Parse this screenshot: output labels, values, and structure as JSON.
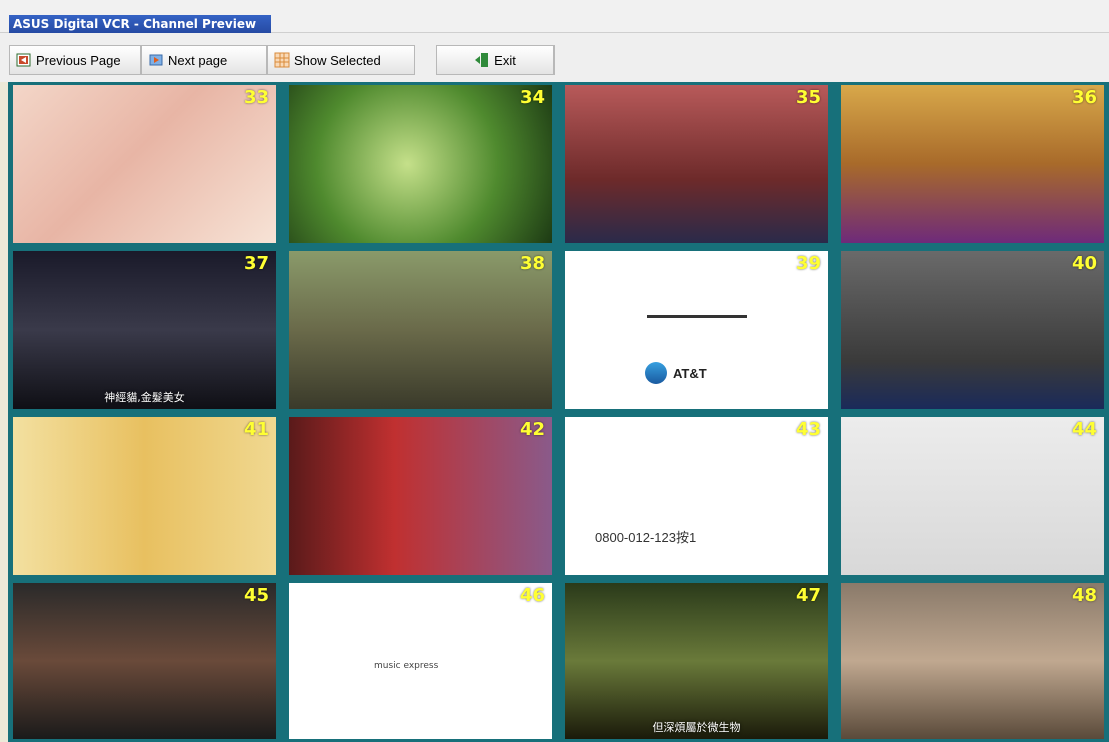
{
  "window": {
    "title": "ASUS Digital VCR - Channel Preview"
  },
  "toolbar": {
    "previous_label": "Previous Page",
    "next_label": "Next page",
    "show_selected_label": "Show Selected",
    "exit_label": "Exit"
  },
  "channels": [
    {
      "number": "33",
      "caption": ""
    },
    {
      "number": "34",
      "caption": ""
    },
    {
      "number": "35",
      "caption": ""
    },
    {
      "number": "36",
      "caption": ""
    },
    {
      "number": "37",
      "caption": "神經貓,金髮美女"
    },
    {
      "number": "38",
      "caption": ""
    },
    {
      "number": "39",
      "caption": "AT&T"
    },
    {
      "number": "40",
      "caption": ""
    },
    {
      "number": "41",
      "caption": ""
    },
    {
      "number": "42",
      "caption": ""
    },
    {
      "number": "43",
      "caption": "0800-012-123按1"
    },
    {
      "number": "44",
      "caption": ""
    },
    {
      "number": "45",
      "caption": ""
    },
    {
      "number": "46",
      "caption": "music express"
    },
    {
      "number": "47",
      "caption": "但深煩屬於微生物"
    },
    {
      "number": "48",
      "caption": ""
    }
  ],
  "colors": {
    "grid_border": "#17707a",
    "channel_number": "#ffff33",
    "title_bar": "#264aa3"
  }
}
